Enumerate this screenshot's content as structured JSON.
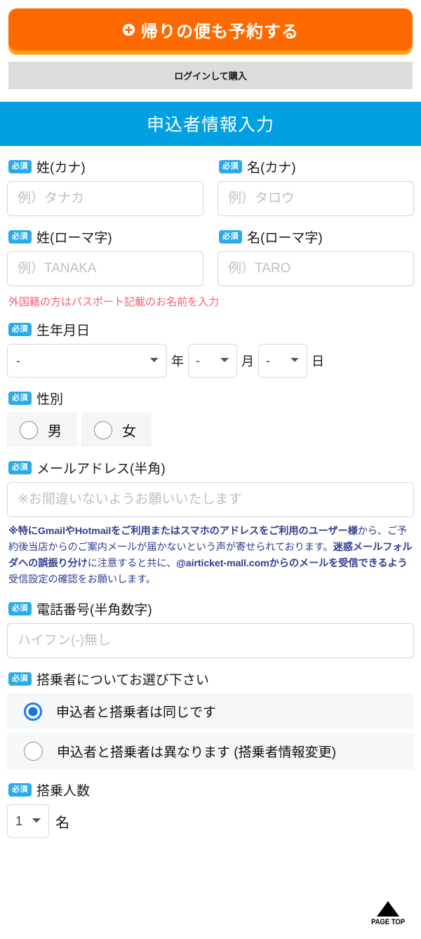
{
  "top_actions": {
    "return_flight_button": "帰りの便も予約する",
    "return_flight_icon": "plus-circle-icon",
    "login_button": "ログインして購入"
  },
  "section": {
    "title": "申込者情報入力"
  },
  "required_badge": "必須",
  "fields": {
    "surname_kana": {
      "label": "姓(カナ)",
      "placeholder": "例）タナカ",
      "value": ""
    },
    "givenname_kana": {
      "label": "名(カナ)",
      "placeholder": "例）タロウ",
      "value": ""
    },
    "surname_roman": {
      "label": "姓(ローマ字)",
      "placeholder": "例）TANAKA",
      "value": ""
    },
    "givenname_roman": {
      "label": "名(ローマ字)",
      "placeholder": "例）TARO",
      "value": ""
    },
    "passport_note": "外国籍の方はパスポート記載のお名前を入力",
    "birthdate": {
      "label": "生年月日",
      "year_value": "-",
      "year_unit": "年",
      "month_value": "-",
      "month_unit": "月",
      "day_value": "-",
      "day_unit": "日"
    },
    "gender": {
      "label": "性別",
      "options": [
        {
          "label": "男",
          "selected": false
        },
        {
          "label": "女",
          "selected": false
        }
      ]
    },
    "email": {
      "label": "メールアドレス(半角)",
      "placeholder": "※お間違いないようお願いいたします",
      "value": "",
      "warning_parts": [
        {
          "text": "※特にGmailやHotmailをご利用またはスマホのアドレスをご利用のユーザー様",
          "bold": true
        },
        {
          "text": "から、ご予約後当店からのご案内メールが届かないという声が寄せられております。",
          "bold": false
        },
        {
          "text": "迷惑メールフォルダへの誤振り分け",
          "bold": true
        },
        {
          "text": "に注意すると共に、",
          "bold": false
        },
        {
          "text": "@airticket-mall.comからのメールを受信できるよう",
          "bold": true
        },
        {
          "text": "受信設定の確認をお願いします。",
          "bold": false
        }
      ]
    },
    "phone": {
      "label": "電話番号(半角数字)",
      "placeholder": "ハイフン(-)無し",
      "value": ""
    },
    "passenger_choice": {
      "label": "搭乗者についてお選び下さい",
      "options": [
        {
          "label": "申込者と搭乗者は同じです",
          "selected": true
        },
        {
          "label": "申込者と搭乗者は異なります (搭乗者情報変更)",
          "selected": false
        }
      ]
    },
    "passenger_count": {
      "label": "搭乗人数",
      "value": "1",
      "unit": "名"
    }
  },
  "page_top": {
    "label": "PAGE TOP",
    "icon": "triangle-up-icon"
  },
  "colors": {
    "orange": "#ff6a00",
    "orange_shadow": "#ffa01e",
    "header_blue": "#00a0e3",
    "badge_blue": "#29abe8",
    "note_red": "#ff5a6e",
    "warning_navy": "#2e3f91",
    "radio_blue": "#1573e6"
  }
}
